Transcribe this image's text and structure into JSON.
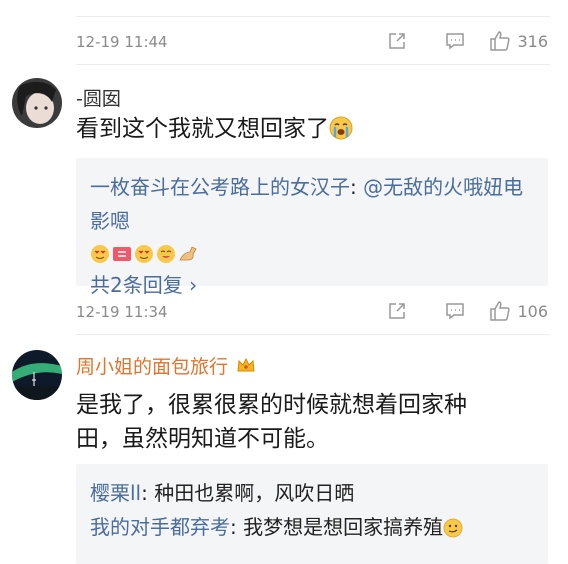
{
  "comments": [
    {
      "meta": {
        "time": "12-19 11:44",
        "like_count": "316"
      }
    },
    {
      "author": "-圆囡",
      "text": "看到这个我就又想回家了",
      "emoji": "crying-face-icon",
      "replies": {
        "line1_author": "一枚奋斗在公考路上的女汉子",
        "line1_colon": ": ",
        "line1_text": "@无敌的火哦妞电影嗯",
        "emojis": [
          "heart-eyes-face-icon",
          "love-tag-icon",
          "heart-eyes-face-icon",
          "heart-eyes-face-icon",
          "flexed-arm-icon"
        ],
        "more": "共2条回复 ›"
      },
      "meta": {
        "time": "12-19 11:34",
        "like_count": "106"
      }
    },
    {
      "author": "周小姐的面包旅行",
      "badge": "crown-icon",
      "text_line1": "是我了，很累很累的时候就想着回家种",
      "text_line2": "田，虽然明知道不可能。",
      "replies": [
        {
          "author": "樱栗ll",
          "colon": ": ",
          "text": "种田也累啊，风吹日晒"
        },
        {
          "author": "我的对手都弃考",
          "colon": ": ",
          "text": "我梦想是想回家搞养殖",
          "emoji": "smirk-face-icon"
        }
      ]
    }
  ],
  "colors": {
    "link_blue": "#4a6d9e",
    "vip_orange": "#e2742d",
    "meta_gray": "#8a8a8a",
    "reply_bg": "#f4f5f7"
  }
}
